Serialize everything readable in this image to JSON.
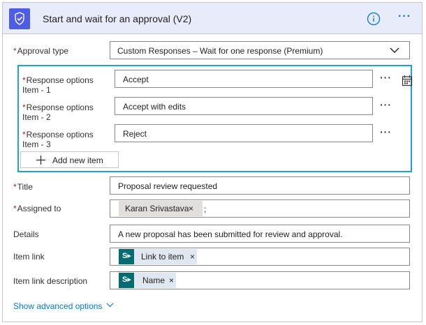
{
  "header": {
    "title": "Start and wait for an approval (V2)",
    "more": "···"
  },
  "approval_type": {
    "label": "Approval type",
    "required_mark": "*",
    "value": "Custom Responses – Wait for one response (Premium)"
  },
  "response_options": {
    "items": [
      {
        "label_line1": "Response options",
        "label_line2": "Item - 1",
        "value": "Accept"
      },
      {
        "label_line1": "Response options",
        "label_line2": "Item - 2",
        "value": "Accept with edits"
      },
      {
        "label_line1": "Response options",
        "label_line2": "Item - 3",
        "value": "Reject"
      }
    ],
    "more": "···",
    "add_label": "Add new item"
  },
  "title_field": {
    "label": "Title",
    "value": "Proposal review requested"
  },
  "assigned_to": {
    "label": "Assigned to",
    "token": "Karan Srivastava",
    "remove": "×",
    "separator": ";"
  },
  "details": {
    "label": "Details",
    "value": "A new proposal has been submitted for review and approval."
  },
  "item_link": {
    "label": "Item link",
    "token": "Link to item",
    "remove": "×"
  },
  "item_link_description": {
    "label": "Item link description",
    "token": "Name",
    "remove": "×"
  },
  "advanced": {
    "label": "Show advanced options"
  },
  "colors": {
    "header_bg": "#e8ebf9",
    "icon_bg": "#4e5ce6",
    "accent": "#0078d4",
    "group_border": "#1aa3d8",
    "sharepoint": "#036c70",
    "required": "#a4262c"
  }
}
